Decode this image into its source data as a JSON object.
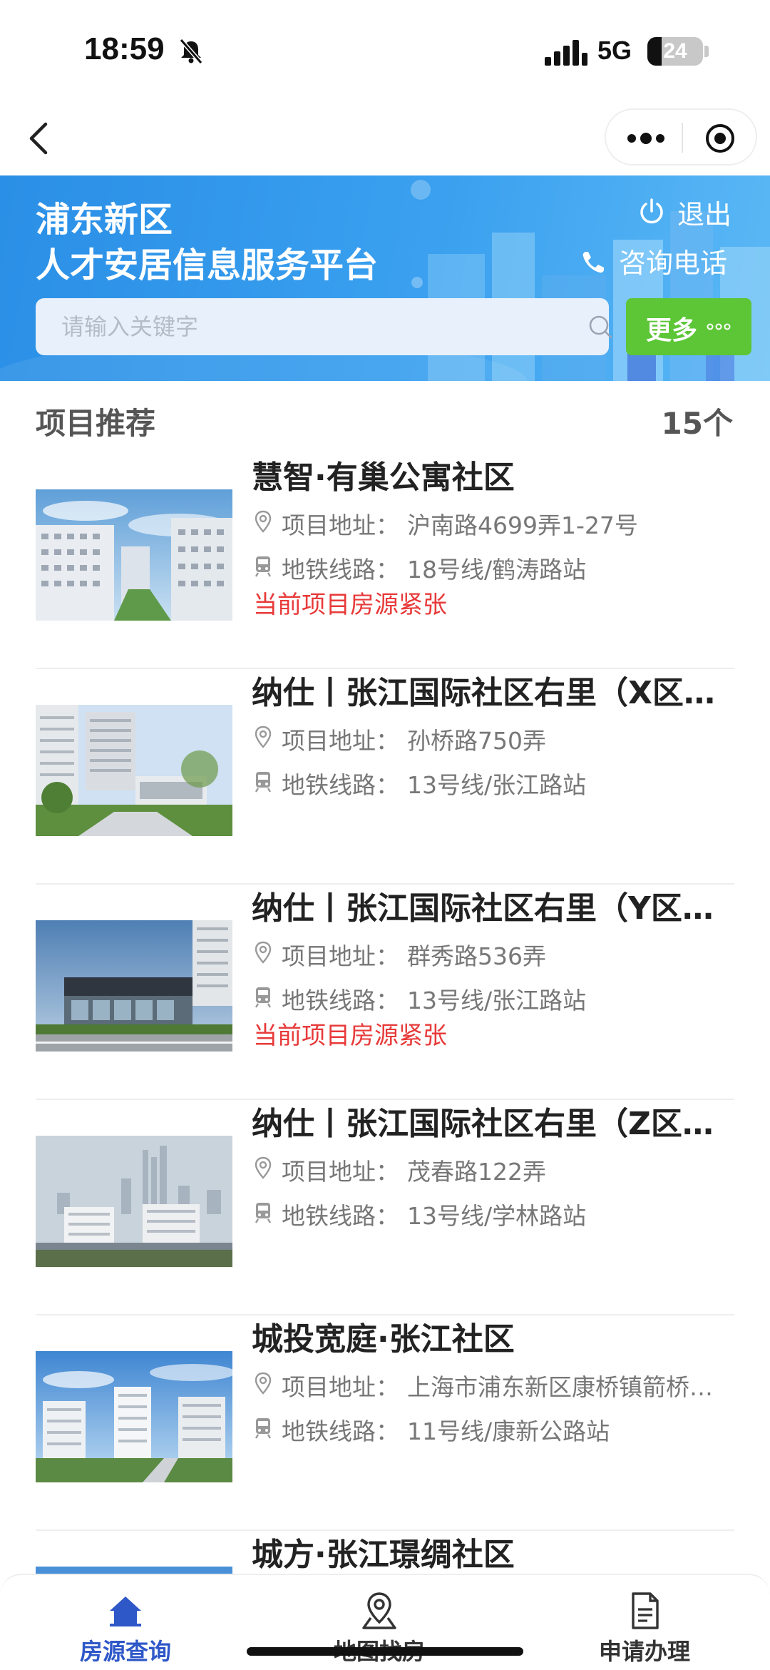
{
  "status_bar": {
    "time": "18:59",
    "network": "5G",
    "battery": "24"
  },
  "banner": {
    "title_line1": "浦东新区",
    "title_line2": "人才安居信息服务平台",
    "logout_label": "退出",
    "phone_label": "咨询电话",
    "search_placeholder": "请输入关键字",
    "more_label": "更多"
  },
  "section": {
    "title": "项目推荐",
    "count": "15个"
  },
  "labels": {
    "address": "项目地址：",
    "metro": "地铁线路："
  },
  "projects": [
    {
      "name": "慧智·有巢公寓社区",
      "address": "沪南路4699弄1-27号",
      "metro": "18号线/鹤涛路站",
      "warning": "当前项目房源紧张"
    },
    {
      "name": "纳仕丨张江国际社区右里（X区…",
      "address": "孙桥路750弄",
      "metro": "13号线/张江路站",
      "warning": ""
    },
    {
      "name": "纳仕丨张江国际社区右里（Y区…",
      "address": "群秀路536弄",
      "metro": "13号线/张江路站",
      "warning": "当前项目房源紧张"
    },
    {
      "name": "纳仕丨张江国际社区右里（Z区…",
      "address": " 茂春路122弄",
      "metro": "13号线/学林路站",
      "warning": ""
    },
    {
      "name": "城投宽庭·张江社区",
      "address": "上海市浦东新区康桥镇箭桥…",
      "metro": "11号线/康新公路站",
      "warning": ""
    },
    {
      "name": "城方·张江璟绸社区",
      "address": "",
      "metro": "",
      "warning": ""
    }
  ],
  "tabs": [
    {
      "label": "房源查询",
      "icon": "home-icon",
      "active": true
    },
    {
      "label": "地图找房",
      "icon": "map-pin-icon",
      "active": false
    },
    {
      "label": "申请办理",
      "icon": "document-icon",
      "active": false
    }
  ],
  "colors": {
    "banner": "#2a8fe6",
    "more_button": "#5cc636",
    "warning": "#e83a3a",
    "active_tab": "#2e57c8"
  }
}
